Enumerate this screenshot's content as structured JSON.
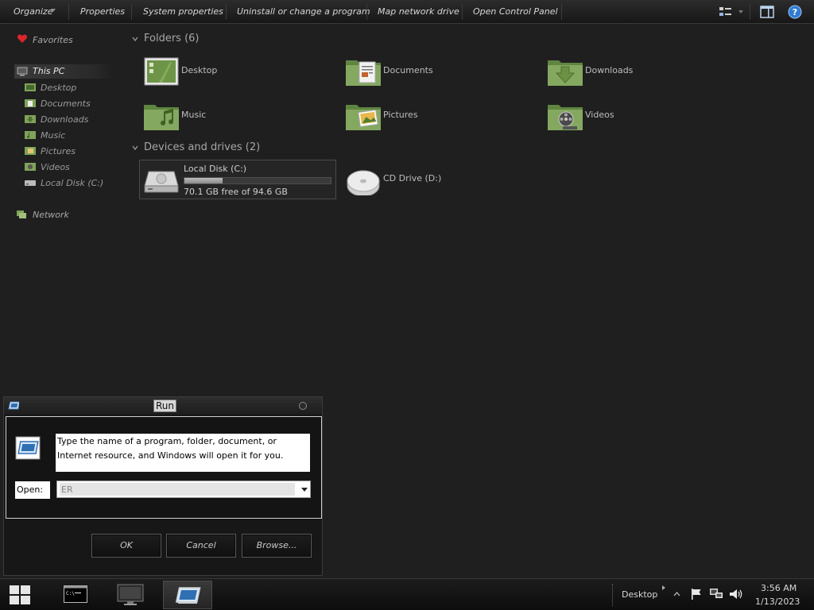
{
  "toolbar": {
    "organize": "Organize",
    "properties": "Properties",
    "system_properties": "System properties",
    "uninstall": "Uninstall or change a program",
    "map_drive": "Map network drive",
    "control_panel": "Open Control Panel"
  },
  "nav": {
    "favorites": "Favorites",
    "this_pc": "This PC",
    "items": [
      "Desktop",
      "Documents",
      "Downloads",
      "Music",
      "Pictures",
      "Videos",
      "Local Disk (C:)"
    ],
    "network": "Network"
  },
  "content": {
    "folders_header": "Folders (6)",
    "folders": [
      "Desktop",
      "Documents",
      "Downloads",
      "Music",
      "Pictures",
      "Videos"
    ],
    "devices_header": "Devices and drives (2)",
    "local_disk": {
      "name": "Local Disk (C:)",
      "free_text": "70.1 GB free of 94.6 GB",
      "used_fraction": 0.26
    },
    "cd_drive": "CD Drive (D:)"
  },
  "run": {
    "title": "Run",
    "description": "Type the name of a program, folder, document, or Internet resource, and Windows will open it for you.",
    "open_label": "Open:",
    "input_value": "ER",
    "ok": "OK",
    "cancel": "Cancel",
    "browse": "Browse..."
  },
  "taskbar": {
    "desktop_label": "Desktop",
    "time": "3:56 AM",
    "date": "1/13/2023"
  },
  "colors": {
    "folder_green": "#7fa35a",
    "background": "#1f1f1f",
    "favorite_heart": "#d8262b"
  }
}
